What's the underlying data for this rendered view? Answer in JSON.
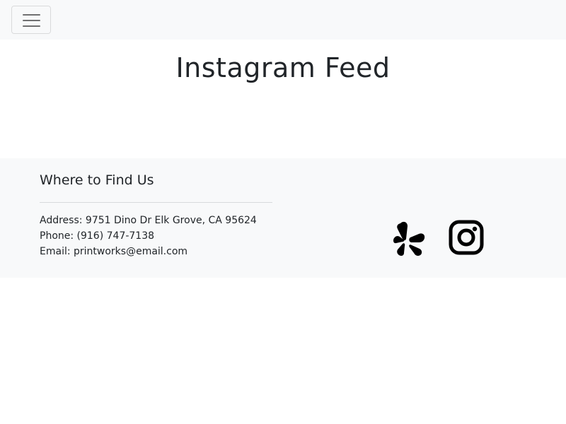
{
  "navbar": {
    "toggle_icon": "hamburger-icon"
  },
  "hero": {
    "title": "Instagram Feed"
  },
  "footer": {
    "heading": "Where to Find Us",
    "address": "Address: 9751 Dino Dr Elk Grove, CA 95624",
    "phone": "Phone: (916) 747-7138",
    "email": "Email: printworks@email.com",
    "social": [
      {
        "name": "Yelp",
        "icon": "yelp-icon"
      },
      {
        "name": "Instagram",
        "icon": "instagram-icon"
      }
    ]
  },
  "colors": {
    "navbar_bg": "#f8f9fa",
    "footer_bg": "#f8f9fa",
    "text": "#212529",
    "icon": "#000000"
  }
}
